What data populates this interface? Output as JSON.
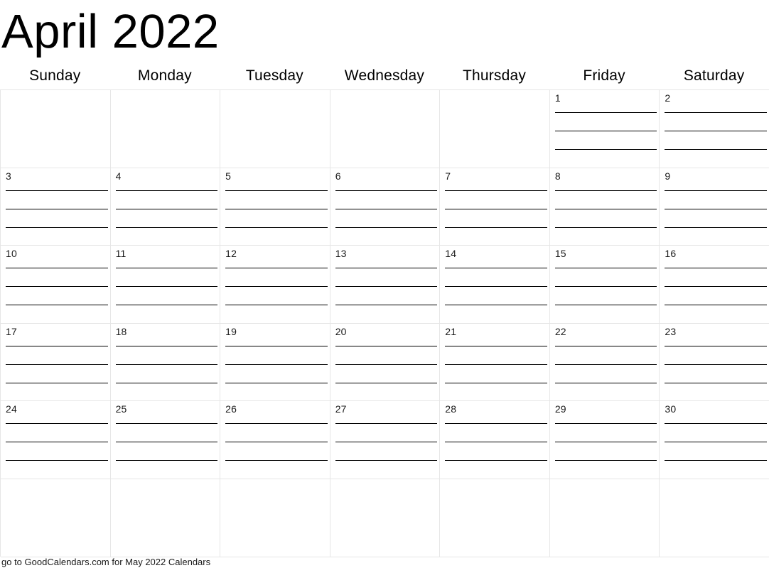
{
  "calendar": {
    "title": "April 2022",
    "month": "April",
    "year": "2022",
    "weekday_headers": [
      {
        "label": "Sunday"
      },
      {
        "label": "Monday"
      },
      {
        "label": "Tuesday"
      },
      {
        "label": "Wednesday"
      },
      {
        "label": "Thursday"
      },
      {
        "label": "Friday"
      },
      {
        "label": "Saturday"
      }
    ],
    "lines_per_day": 4,
    "weeks": [
      {
        "days": [
          {
            "date": "",
            "has_lines": false
          },
          {
            "date": "",
            "has_lines": false
          },
          {
            "date": "",
            "has_lines": false
          },
          {
            "date": "",
            "has_lines": false
          },
          {
            "date": "",
            "has_lines": false
          },
          {
            "date": "1",
            "has_lines": true
          },
          {
            "date": "2",
            "has_lines": true
          }
        ]
      },
      {
        "days": [
          {
            "date": "3",
            "has_lines": true
          },
          {
            "date": "4",
            "has_lines": true
          },
          {
            "date": "5",
            "has_lines": true
          },
          {
            "date": "6",
            "has_lines": true
          },
          {
            "date": "7",
            "has_lines": true
          },
          {
            "date": "8",
            "has_lines": true
          },
          {
            "date": "9",
            "has_lines": true
          }
        ]
      },
      {
        "days": [
          {
            "date": "10",
            "has_lines": true
          },
          {
            "date": "11",
            "has_lines": true
          },
          {
            "date": "12",
            "has_lines": true
          },
          {
            "date": "13",
            "has_lines": true
          },
          {
            "date": "14",
            "has_lines": true
          },
          {
            "date": "15",
            "has_lines": true
          },
          {
            "date": "16",
            "has_lines": true
          }
        ]
      },
      {
        "days": [
          {
            "date": "17",
            "has_lines": true
          },
          {
            "date": "18",
            "has_lines": true
          },
          {
            "date": "19",
            "has_lines": true
          },
          {
            "date": "20",
            "has_lines": true
          },
          {
            "date": "21",
            "has_lines": true
          },
          {
            "date": "22",
            "has_lines": true
          },
          {
            "date": "23",
            "has_lines": true
          }
        ]
      },
      {
        "days": [
          {
            "date": "24",
            "has_lines": true
          },
          {
            "date": "25",
            "has_lines": true
          },
          {
            "date": "26",
            "has_lines": true
          },
          {
            "date": "27",
            "has_lines": true
          },
          {
            "date": "28",
            "has_lines": true
          },
          {
            "date": "29",
            "has_lines": true
          },
          {
            "date": "30",
            "has_lines": true
          }
        ]
      },
      {
        "days": [
          {
            "date": "",
            "has_lines": false
          },
          {
            "date": "",
            "has_lines": false
          },
          {
            "date": "",
            "has_lines": false
          },
          {
            "date": "",
            "has_lines": false
          },
          {
            "date": "",
            "has_lines": false
          },
          {
            "date": "",
            "has_lines": false
          },
          {
            "date": "",
            "has_lines": false
          }
        ]
      }
    ]
  },
  "footer": {
    "note": "go to GoodCalendars.com for May 2022 Calendars"
  },
  "colors": {
    "text": "#000000",
    "grid_border": "#e6e6e6",
    "rule_line": "#000000",
    "background": "#ffffff"
  }
}
